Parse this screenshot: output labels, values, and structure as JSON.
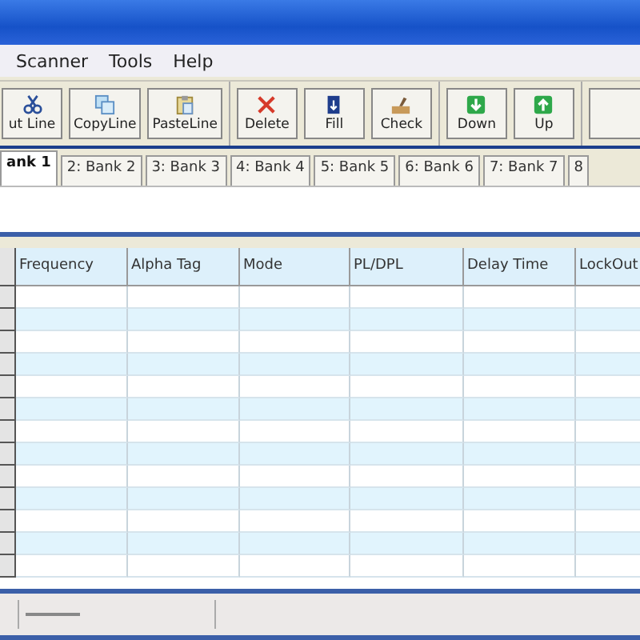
{
  "menu": [
    {
      "label": "Scanner"
    },
    {
      "label": "Tools"
    },
    {
      "label": "Help"
    }
  ],
  "toolbar": [
    [
      {
        "label": "ut Line",
        "kind": "cut"
      },
      {
        "label": "CopyLine",
        "kind": "copy"
      },
      {
        "label": "PasteLine",
        "kind": "paste"
      }
    ],
    [
      {
        "label": "Delete",
        "kind": "delete"
      },
      {
        "label": "Fill",
        "kind": "fill"
      },
      {
        "label": "Check",
        "kind": "check"
      }
    ],
    [
      {
        "label": "Down",
        "kind": "down"
      },
      {
        "label": "Up",
        "kind": "up"
      }
    ],
    [
      {
        "kind": "blank"
      }
    ]
  ],
  "tabs": [
    {
      "label": "ank 1",
      "selected": true
    },
    {
      "label": "2: Bank 2",
      "selected": false
    },
    {
      "label": "3: Bank 3",
      "selected": false
    },
    {
      "label": "4: Bank 4",
      "selected": false
    },
    {
      "label": "5: Bank 5",
      "selected": false
    },
    {
      "label": "6: Bank 6",
      "selected": false
    },
    {
      "label": "7: Bank 7",
      "selected": false
    },
    {
      "label": "8",
      "selected": false
    }
  ],
  "table": {
    "columns": [
      "Frequency",
      "Alpha Tag",
      "Mode",
      "PL/DPL",
      "Delay Time",
      "LockOut"
    ]
  }
}
